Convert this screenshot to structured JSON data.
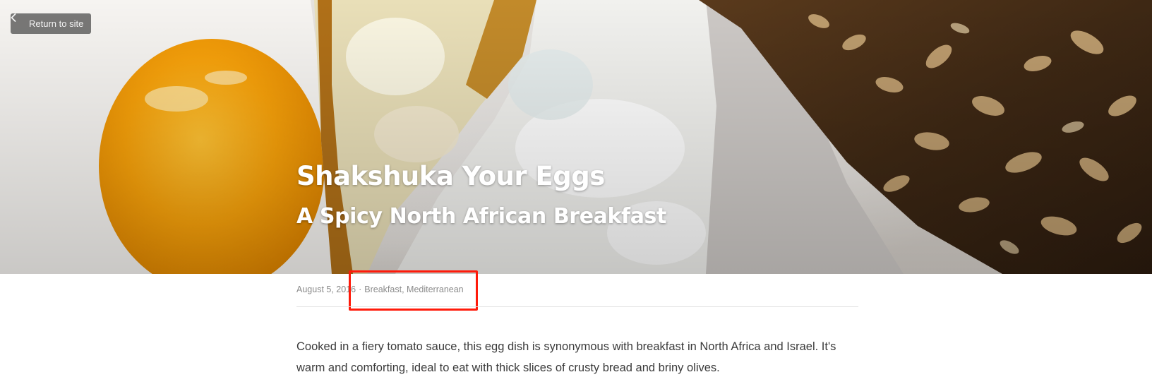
{
  "header": {
    "return_label": "Return to site",
    "title": "Shakshuka Your Eggs",
    "subtitle": "A Spicy North African Breakfast"
  },
  "meta": {
    "date": "August 5, 2016",
    "separator": "·",
    "categories": "Breakfast, Mediterranean"
  },
  "article": {
    "intro": "Cooked in a fiery tomato sauce, this egg dish is synonymous with breakfast in North Africa and Israel. It's warm and comforting, ideal to eat with thick slices of crusty bread and briny olives."
  },
  "icons": {
    "return": "chevron-left-icon"
  },
  "colors": {
    "highlight": "#ff1a0a",
    "yolk": "#f7a10a",
    "text": "#3a3a3a",
    "meta": "#8a8a8a"
  }
}
